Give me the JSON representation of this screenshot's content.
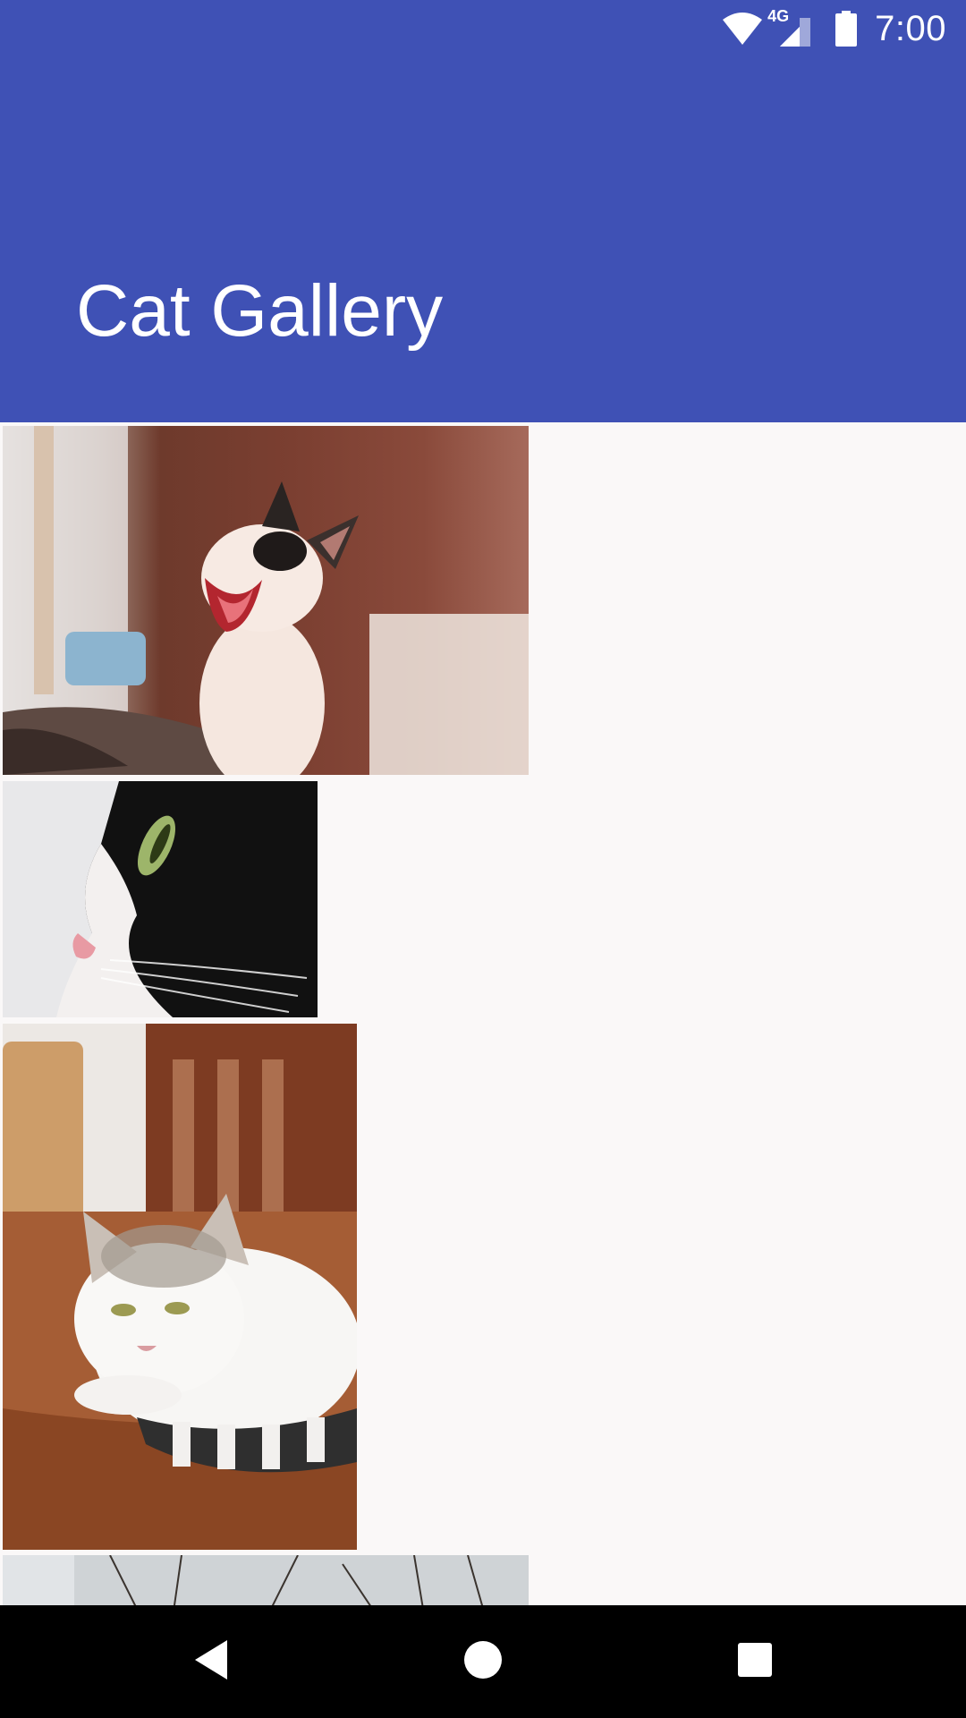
{
  "status_bar": {
    "network_label": "4G",
    "time": "7:00",
    "icons": [
      "wifi-icon",
      "cell-signal-icon",
      "battery-icon"
    ]
  },
  "app_bar": {
    "title": "Cat Gallery",
    "color": "#3f51b5"
  },
  "gallery": {
    "items": [
      {
        "name": "yawning-cat-photo"
      },
      {
        "name": "cat-profile-closeup-photo"
      },
      {
        "name": "lying-cat-on-table-photo"
      },
      {
        "name": "cat-outdoors-photo"
      }
    ]
  },
  "nav_bar": {
    "buttons": [
      "back-button",
      "home-button",
      "recents-button"
    ]
  }
}
